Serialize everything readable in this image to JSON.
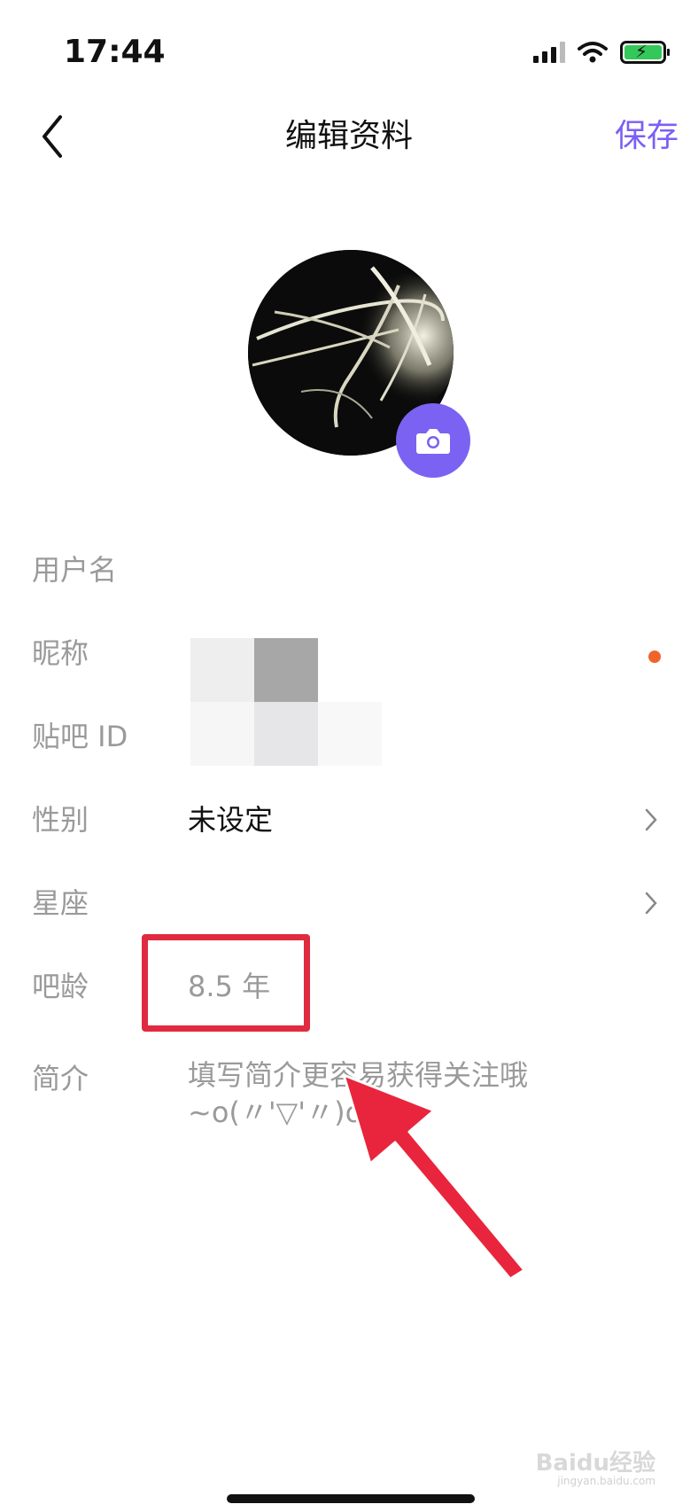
{
  "status_bar": {
    "time": "17:44"
  },
  "nav": {
    "title": "编辑资料",
    "save_label": "保存"
  },
  "form": {
    "username_label": "用户名",
    "nickname_label": "昵称",
    "tieba_id_label": "贴吧 ID",
    "gender_label": "性别",
    "gender_value": "未设定",
    "constellation_label": "星座",
    "tieba_age_label": "吧龄",
    "tieba_age_value": "8.5 年",
    "bio_label": "简介",
    "bio_placeholder_line1": "填写简介更容易获得关注哦",
    "bio_placeholder_line2": "~o(〃'▽'〃)o"
  },
  "colors": {
    "accent": "#7b5ff5",
    "highlight": "#e02a3f",
    "notice_dot": "#f0642c"
  },
  "watermark": {
    "text": "Baidu经验",
    "sub": "jingyan.baidu.com"
  }
}
